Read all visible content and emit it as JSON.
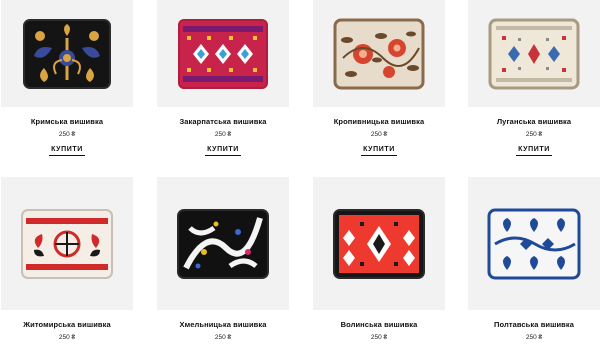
{
  "products": [
    {
      "title": "Кримська вишивка",
      "price": "250 ₴",
      "buy_label": "КУПИТИ",
      "image": "crimean-embroidery-patch"
    },
    {
      "title": "Закарпатська вишивка",
      "price": "250 ₴",
      "buy_label": "КУПИТИ",
      "image": "zakarpattia-embroidery-patch"
    },
    {
      "title": "Кропивницька вишивка",
      "price": "250 ₴",
      "buy_label": "КУПИТИ",
      "image": "kropyvnytskyi-embroidery-patch"
    },
    {
      "title": "Луганська вишивка",
      "price": "250 ₴",
      "buy_label": "КУПИТИ",
      "image": "luhansk-embroidery-patch"
    },
    {
      "title": "Житомирська вишивка",
      "price": "250 ₴",
      "image": "zhytomyr-embroidery-patch"
    },
    {
      "title": "Хмельницька вишивка",
      "price": "250 ₴",
      "image": "khmelnytskyi-embroidery-patch"
    },
    {
      "title": "Волинська вишивка",
      "price": "250 ₴",
      "image": "volyn-embroidery-patch"
    },
    {
      "title": "Полтавська вишивка",
      "price": "250 ₴",
      "image": "poltava-embroidery-patch"
    }
  ],
  "colors": {
    "card_bg": "#f2f2f2",
    "text": "#111111"
  }
}
